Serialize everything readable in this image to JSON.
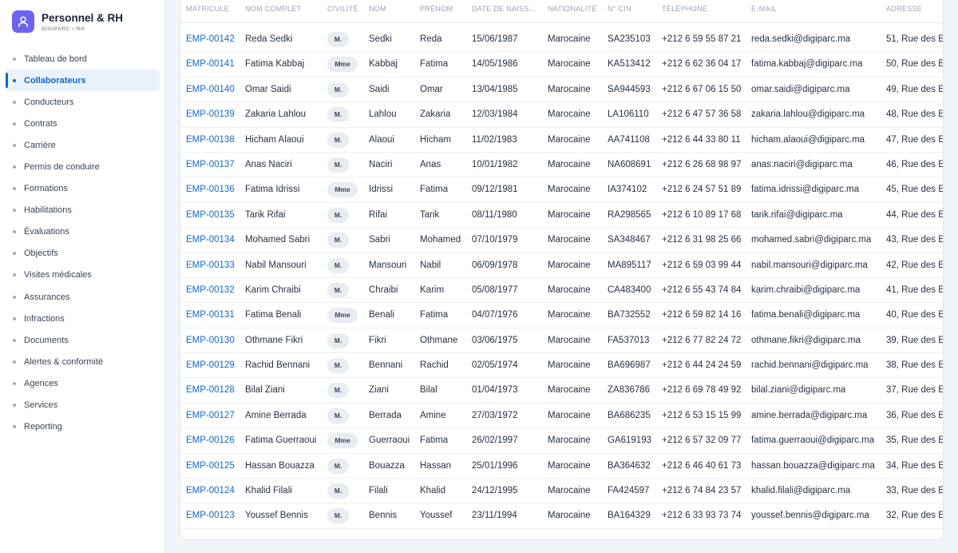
{
  "app": {
    "title": "Personnel & RH",
    "subtitle": "DIGIPARC • RH",
    "accent": "#6d63f2",
    "link_color": "#1468c4",
    "active_color": "#1366c1"
  },
  "sidebar": {
    "items": [
      {
        "label": "Tableau de bord",
        "active": false
      },
      {
        "label": "Collaborateurs",
        "active": true
      },
      {
        "label": "Conducteurs",
        "active": false
      },
      {
        "label": "Contrats",
        "active": false
      },
      {
        "label": "Carrière",
        "active": false
      },
      {
        "label": "Permis de conduire",
        "active": false
      },
      {
        "label": "Formations",
        "active": false
      },
      {
        "label": "Habilitations",
        "active": false
      },
      {
        "label": "Évaluations",
        "active": false
      },
      {
        "label": "Objectifs",
        "active": false
      },
      {
        "label": "Visites médicales",
        "active": false
      },
      {
        "label": "Assurances",
        "active": false
      },
      {
        "label": "Infractions",
        "active": false
      },
      {
        "label": "Documents",
        "active": false
      },
      {
        "label": "Alertes & conformité",
        "active": false
      },
      {
        "label": "Agences",
        "active": false
      },
      {
        "label": "Services",
        "active": false
      },
      {
        "label": "Reporting",
        "active": false
      }
    ]
  },
  "table": {
    "columns": [
      "MATRICULE",
      "NOM COMPLET",
      "CIVILITÉ",
      "NOM",
      "PRÉNOM",
      "DATE DE NAISS…",
      "NATIONALITÉ",
      "N° CIN",
      "TÉLÉPHONE",
      "E-MAIL",
      "ADRESSE"
    ],
    "rows": [
      {
        "matricule": "EMP-00142",
        "nom_complet": "Reda Sedki",
        "civilite": "M.",
        "nom": "Sedki",
        "prenom": "Reda",
        "date": "15/06/1987",
        "nationalite": "Marocaine",
        "cin": "SA235103",
        "tel": "+212 6 59 55 87 21",
        "email": "reda.sedki@digiparc.ma",
        "adresse": "51, Rue des E"
      },
      {
        "matricule": "EMP-00141",
        "nom_complet": "Fatima Kabbaj",
        "civilite": "Mme",
        "nom": "Kabbaj",
        "prenom": "Fatima",
        "date": "14/05/1986",
        "nationalite": "Marocaine",
        "cin": "KA513412",
        "tel": "+212 6 62 36 04 17",
        "email": "fatima.kabbaj@digiparc.ma",
        "adresse": "50, Rue des E"
      },
      {
        "matricule": "EMP-00140",
        "nom_complet": "Omar Saidi",
        "civilite": "M.",
        "nom": "Saidi",
        "prenom": "Omar",
        "date": "13/04/1985",
        "nationalite": "Marocaine",
        "cin": "SA944593",
        "tel": "+212 6 67 06 15 50",
        "email": "omar.saidi@digiparc.ma",
        "adresse": "49, Rue des E"
      },
      {
        "matricule": "EMP-00139",
        "nom_complet": "Zakaria Lahlou",
        "civilite": "M.",
        "nom": "Lahlou",
        "prenom": "Zakaria",
        "date": "12/03/1984",
        "nationalite": "Marocaine",
        "cin": "LA106110",
        "tel": "+212 6 47 57 36 58",
        "email": "zakaria.lahlou@digiparc.ma",
        "adresse": "48, Rue des E"
      },
      {
        "matricule": "EMP-00138",
        "nom_complet": "Hicham Alaoui",
        "civilite": "M.",
        "nom": "Alaoui",
        "prenom": "Hicham",
        "date": "11/02/1983",
        "nationalite": "Marocaine",
        "cin": "AA741108",
        "tel": "+212 6 44 33 80 11",
        "email": "hicham.alaoui@digiparc.ma",
        "adresse": "47, Rue des E"
      },
      {
        "matricule": "EMP-00137",
        "nom_complet": "Anas Naciri",
        "civilite": "M.",
        "nom": "Naciri",
        "prenom": "Anas",
        "date": "10/01/1982",
        "nationalite": "Marocaine",
        "cin": "NA608691",
        "tel": "+212 6 26 68 98 97",
        "email": "anas.naciri@digiparc.ma",
        "adresse": "46, Rue des E"
      },
      {
        "matricule": "EMP-00136",
        "nom_complet": "Fatima Idrissi",
        "civilite": "Mme",
        "nom": "Idrissi",
        "prenom": "Fatima",
        "date": "09/12/1981",
        "nationalite": "Marocaine",
        "cin": "IA374102",
        "tel": "+212 6 24 57 51 89",
        "email": "fatima.idrissi@digiparc.ma",
        "adresse": "45, Rue des E"
      },
      {
        "matricule": "EMP-00135",
        "nom_complet": "Tarik Rifai",
        "civilite": "M.",
        "nom": "Rifai",
        "prenom": "Tarik",
        "date": "08/11/1980",
        "nationalite": "Marocaine",
        "cin": "RA298565",
        "tel": "+212 6 10 89 17 68",
        "email": "tarik.rifai@digiparc.ma",
        "adresse": "44, Rue des E"
      },
      {
        "matricule": "EMP-00134",
        "nom_complet": "Mohamed Sabri",
        "civilite": "M.",
        "nom": "Sabri",
        "prenom": "Mohamed",
        "date": "07/10/1979",
        "nationalite": "Marocaine",
        "cin": "SA348467",
        "tel": "+212 6 31 98 25 66",
        "email": "mohamed.sabri@digiparc.ma",
        "adresse": "43, Rue des E"
      },
      {
        "matricule": "EMP-00133",
        "nom_complet": "Nabil Mansouri",
        "civilite": "M.",
        "nom": "Mansouri",
        "prenom": "Nabil",
        "date": "06/09/1978",
        "nationalite": "Marocaine",
        "cin": "MA895117",
        "tel": "+212 6 59 03 99 44",
        "email": "nabil.mansouri@digiparc.ma",
        "adresse": "42, Rue des E"
      },
      {
        "matricule": "EMP-00132",
        "nom_complet": "Karim Chraibi",
        "civilite": "M.",
        "nom": "Chraibi",
        "prenom": "Karim",
        "date": "05/08/1977",
        "nationalite": "Marocaine",
        "cin": "CA483400",
        "tel": "+212 6 55 43 74 84",
        "email": "karim.chraibi@digiparc.ma",
        "adresse": "41, Rue des E"
      },
      {
        "matricule": "EMP-00131",
        "nom_complet": "Fatima Benali",
        "civilite": "Mme",
        "nom": "Benali",
        "prenom": "Fatima",
        "date": "04/07/1976",
        "nationalite": "Marocaine",
        "cin": "BA732552",
        "tel": "+212 6 59 82 14 16",
        "email": "fatima.benali@digiparc.ma",
        "adresse": "40, Rue des E"
      },
      {
        "matricule": "EMP-00130",
        "nom_complet": "Othmane Fikri",
        "civilite": "M.",
        "nom": "Fikri",
        "prenom": "Othmane",
        "date": "03/06/1975",
        "nationalite": "Marocaine",
        "cin": "FA537013",
        "tel": "+212 6 77 82 24 72",
        "email": "othmane.fikri@digiparc.ma",
        "adresse": "39, Rue des E"
      },
      {
        "matricule": "EMP-00129",
        "nom_complet": "Rachid Bennani",
        "civilite": "M.",
        "nom": "Bennani",
        "prenom": "Rachid",
        "date": "02/05/1974",
        "nationalite": "Marocaine",
        "cin": "BA696987",
        "tel": "+212 6 44 24 24 59",
        "email": "rachid.bennani@digiparc.ma",
        "adresse": "38, Rue des E"
      },
      {
        "matricule": "EMP-00128",
        "nom_complet": "Bilal Ziani",
        "civilite": "M.",
        "nom": "Ziani",
        "prenom": "Bilal",
        "date": "01/04/1973",
        "nationalite": "Marocaine",
        "cin": "ZA836786",
        "tel": "+212 6 69 78 49 92",
        "email": "bilal.ziani@digiparc.ma",
        "adresse": "37, Rue des E"
      },
      {
        "matricule": "EMP-00127",
        "nom_complet": "Amine Berrada",
        "civilite": "M.",
        "nom": "Berrada",
        "prenom": "Amine",
        "date": "27/03/1972",
        "nationalite": "Marocaine",
        "cin": "BA686235",
        "tel": "+212 6 53 15 15 99",
        "email": "amine.berrada@digiparc.ma",
        "adresse": "36, Rue des E"
      },
      {
        "matricule": "EMP-00126",
        "nom_complet": "Fatima Guerraoui",
        "civilite": "Mme",
        "nom": "Guerraoui",
        "prenom": "Fatima",
        "date": "26/02/1997",
        "nationalite": "Marocaine",
        "cin": "GA619193",
        "tel": "+212 6 57 32 09 77",
        "email": "fatima.guerraoui@digiparc.ma",
        "adresse": "35, Rue des E"
      },
      {
        "matricule": "EMP-00125",
        "nom_complet": "Hassan Bouazza",
        "civilite": "M.",
        "nom": "Bouazza",
        "prenom": "Hassan",
        "date": "25/01/1996",
        "nationalite": "Marocaine",
        "cin": "BA364632",
        "tel": "+212 6 46 40 61 73",
        "email": "hassan.bouazza@digiparc.ma",
        "adresse": "34, Rue des E"
      },
      {
        "matricule": "EMP-00124",
        "nom_complet": "Khalid Filali",
        "civilite": "M.",
        "nom": "Filali",
        "prenom": "Khalid",
        "date": "24/12/1995",
        "nationalite": "Marocaine",
        "cin": "FA424597",
        "tel": "+212 6 74 84 23 57",
        "email": "khalid.filali@digiparc.ma",
        "adresse": "33, Rue des E"
      },
      {
        "matricule": "EMP-00123",
        "nom_complet": "Youssef Bennis",
        "civilite": "M.",
        "nom": "Bennis",
        "prenom": "Youssef",
        "date": "23/11/1994",
        "nationalite": "Marocaine",
        "cin": "BA164329",
        "tel": "+212 6 33 93 73 74",
        "email": "youssef.bennis@digiparc.ma",
        "adresse": "32, Rue des E"
      }
    ]
  }
}
